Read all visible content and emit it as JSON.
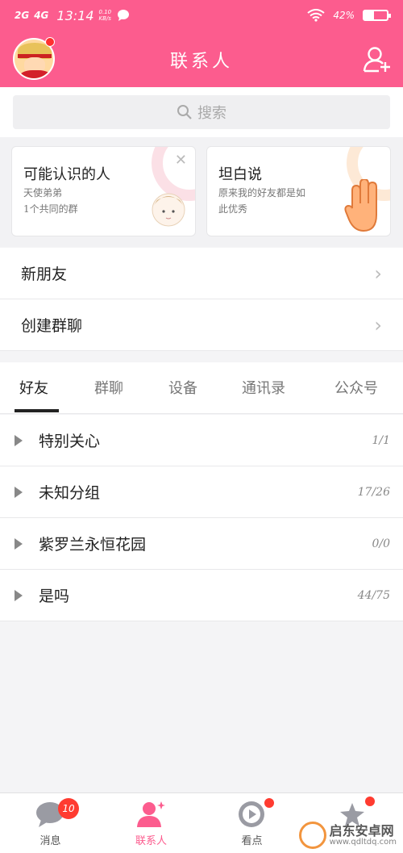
{
  "status_bar": {
    "net1": "2G",
    "net2": "4G",
    "time": "13:14",
    "speed_top": "0.10",
    "speed_bottom": "KB/s",
    "battery": "42%",
    "battery_level": 0.42
  },
  "header": {
    "title": "联系人"
  },
  "search": {
    "placeholder": "搜索"
  },
  "cards": [
    {
      "title": "可能认识的人",
      "line1": "天使弟弟",
      "line2": "1个共同的群"
    },
    {
      "title": "坦白说",
      "line1": "原来我的好友都是如",
      "line2": "此优秀"
    }
  ],
  "menu": [
    {
      "label": "新朋友"
    },
    {
      "label": "创建群聊"
    }
  ],
  "tabs": [
    {
      "label": "好友"
    },
    {
      "label": "群聊"
    },
    {
      "label": "设备"
    },
    {
      "label": "通讯录"
    },
    {
      "label": "公众号"
    }
  ],
  "groups": [
    {
      "name": "特别关心",
      "count": "1/1"
    },
    {
      "name": "未知分组",
      "count": "17/26"
    },
    {
      "name": "紫罗兰永恒花园",
      "count": "0/0"
    },
    {
      "name": "是吗",
      "count": "44/75"
    }
  ],
  "bottom_nav": [
    {
      "label": "消息",
      "badge": "10",
      "icon": "chat-bubble-icon"
    },
    {
      "label": "联系人",
      "icon": "contacts-person-icon"
    },
    {
      "label": "看点",
      "icon": "play-circle-icon"
    },
    {
      "label": "",
      "icon": "star-icon"
    }
  ],
  "watermark": {
    "name": "启东安卓网",
    "url": "www.qdltdq.com"
  },
  "colors": {
    "brand": "#fc5c8e",
    "badge": "#ff3b30"
  }
}
